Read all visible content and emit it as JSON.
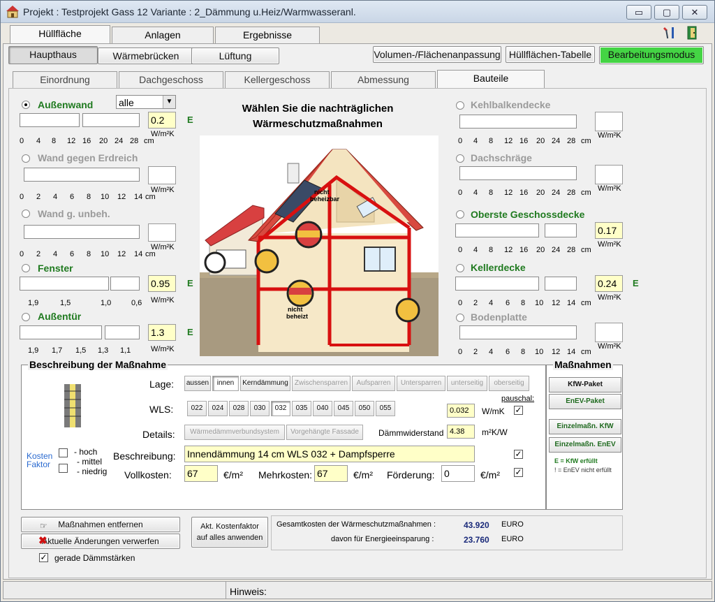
{
  "window": {
    "title": "Projekt : Testprojekt Gass 12  Variante : 2_Dämmung u.Heiz/Warmwasseranl.",
    "minimize": "▭",
    "maximize": "▢",
    "close": "✕"
  },
  "main_tabs": [
    "Hüllfläche",
    "Anlagen",
    "Ergebnisse"
  ],
  "sub_buttons": [
    "Haupthaus",
    "Wärmebrücken",
    "Lüftung"
  ],
  "right_buttons": [
    "Volumen-/Flächenanpassung",
    "Hüllflächen-Tabelle",
    "Bearbeitungsmodus"
  ],
  "sec_tabs": [
    "Einordnung",
    "Dachgeschoss",
    "Kellergeschoss",
    "Abmessung",
    "Bauteile"
  ],
  "heading": [
    "Wählen Sie die nachträglichen",
    "Wärmeschutzmaßnahmen"
  ],
  "left": {
    "aussenwand": {
      "label": "Außenwand",
      "dropdown": "alle",
      "value": "0.2",
      "unit": "W/m²K",
      "flag": "E",
      "scale": [
        "0",
        "4",
        "8",
        "12",
        "16",
        "20",
        "24",
        "28",
        "cm"
      ]
    },
    "erdreich": {
      "label": "Wand gegen Erdreich",
      "unit": "W/m²K",
      "scale": [
        "0",
        "2",
        "4",
        "6",
        "8",
        "10",
        "12",
        "14",
        "cm"
      ]
    },
    "unbeh": {
      "label": "Wand g. unbeh.",
      "unit": "W/m²K",
      "scale": [
        "0",
        "2",
        "4",
        "6",
        "8",
        "10",
        "12",
        "14",
        "cm"
      ]
    },
    "fenster": {
      "label": "Fenster",
      "value": "0.95",
      "unit": "W/m²K",
      "flag": "E",
      "scale": [
        "1,9",
        "1,5",
        "1,0",
        "0,6"
      ]
    },
    "aussentuer": {
      "label": "Außentür",
      "value": "1.3",
      "unit": "W/m²K",
      "flag": "E",
      "scale": [
        "1,9",
        "1,7",
        "1,5",
        "1,3",
        "1,1"
      ]
    }
  },
  "right": {
    "kehlbalken": {
      "label": "Kehlbalkendecke",
      "unit": "W/m²K",
      "scale": [
        "0",
        "4",
        "8",
        "12",
        "16",
        "20",
        "24",
        "28",
        "cm"
      ]
    },
    "dachschraege": {
      "label": "Dachschräge",
      "unit": "W/m²K",
      "scale": [
        "0",
        "4",
        "8",
        "12",
        "16",
        "20",
        "24",
        "28",
        "cm"
      ]
    },
    "oberste": {
      "label": "Oberste Geschossdecke",
      "value": "0.17",
      "unit": "W/m²K",
      "scale": [
        "0",
        "4",
        "8",
        "12",
        "16",
        "20",
        "24",
        "28",
        "cm"
      ]
    },
    "keller": {
      "label": "Kellerdecke",
      "value": "0.24",
      "unit": "W/m²K",
      "flag": "E",
      "scale": [
        "0",
        "2",
        "4",
        "6",
        "8",
        "10",
        "12",
        "14",
        "cm"
      ]
    },
    "boden": {
      "label": "Bodenplatte",
      "unit": "W/m²K",
      "scale": [
        "0",
        "2",
        "4",
        "6",
        "8",
        "10",
        "12",
        "14",
        "cm"
      ]
    }
  },
  "house": {
    "label_top": [
      "nicht",
      "beheizbar"
    ],
    "label_bottom": [
      "nicht",
      "beheizt"
    ]
  },
  "beschreibung": {
    "title": "Beschreibung der Maßnahme",
    "lage_label": "Lage:",
    "lage": [
      "aussen",
      "innen",
      "Kerndämmung",
      "Zwischensparren",
      "Aufsparren",
      "Untersparren",
      "unterseitig",
      "oberseitig"
    ],
    "wls_label": "WLS:",
    "wls": [
      "022",
      "024",
      "028",
      "030",
      "032",
      "035",
      "040",
      "045",
      "050",
      "055"
    ],
    "wls_value": "0.032",
    "wls_unit": "W/mK",
    "pauschal": "pauschal:",
    "details_label": "Details:",
    "details": [
      "Wärmedämmverbundsystem",
      "Vorgehängte Fassade"
    ],
    "daemm_label": "Dämmwiderstand",
    "daemm_value": "4.38",
    "daemm_unit": "m²K/W",
    "kosten_label": [
      "Kosten",
      "Faktor"
    ],
    "kosten_opts": [
      "- hoch",
      "- mittel",
      "- niedrig"
    ],
    "beschr_label": "Beschreibung:",
    "beschr_value": "Innendämmung 14 cm WLS 032 + Dampfsperre",
    "voll_label": "Vollkosten:",
    "voll_value": "67",
    "mehr_label": "Mehrkosten:",
    "mehr_value": "67",
    "eur_unit": "€/m²",
    "foerd_label": "Förderung:",
    "foerd_value": "0"
  },
  "massnahmen": {
    "title": "Maßnahmen",
    "buttons": [
      "KfW-Paket",
      "EnEV-Paket",
      "Einzelmaßn. KfW",
      "Einzelmaßn. EnEV"
    ],
    "note1": "E = KfW erfüllt",
    "note2": "! = EnEV nicht erfüllt"
  },
  "bottom": {
    "entfernen": "Maßnahmen entfernen",
    "verwerfen": "Aktuelle Änderungen verwerfen",
    "gerade": "gerade Dämmstärken",
    "akt": [
      "Akt. Kostenfaktor",
      "auf alles anwenden"
    ],
    "gesamt_label": "Gesamtkosten der Wärmeschutzmaßnahmen :",
    "gesamt_value": "43.920",
    "gesamt_unit": "EURO",
    "davon_label": "davon für Energieeinsparung :",
    "davon_value": "23.760",
    "davon_unit": "EURO"
  },
  "status": {
    "hinweis": "Hinweis:"
  }
}
